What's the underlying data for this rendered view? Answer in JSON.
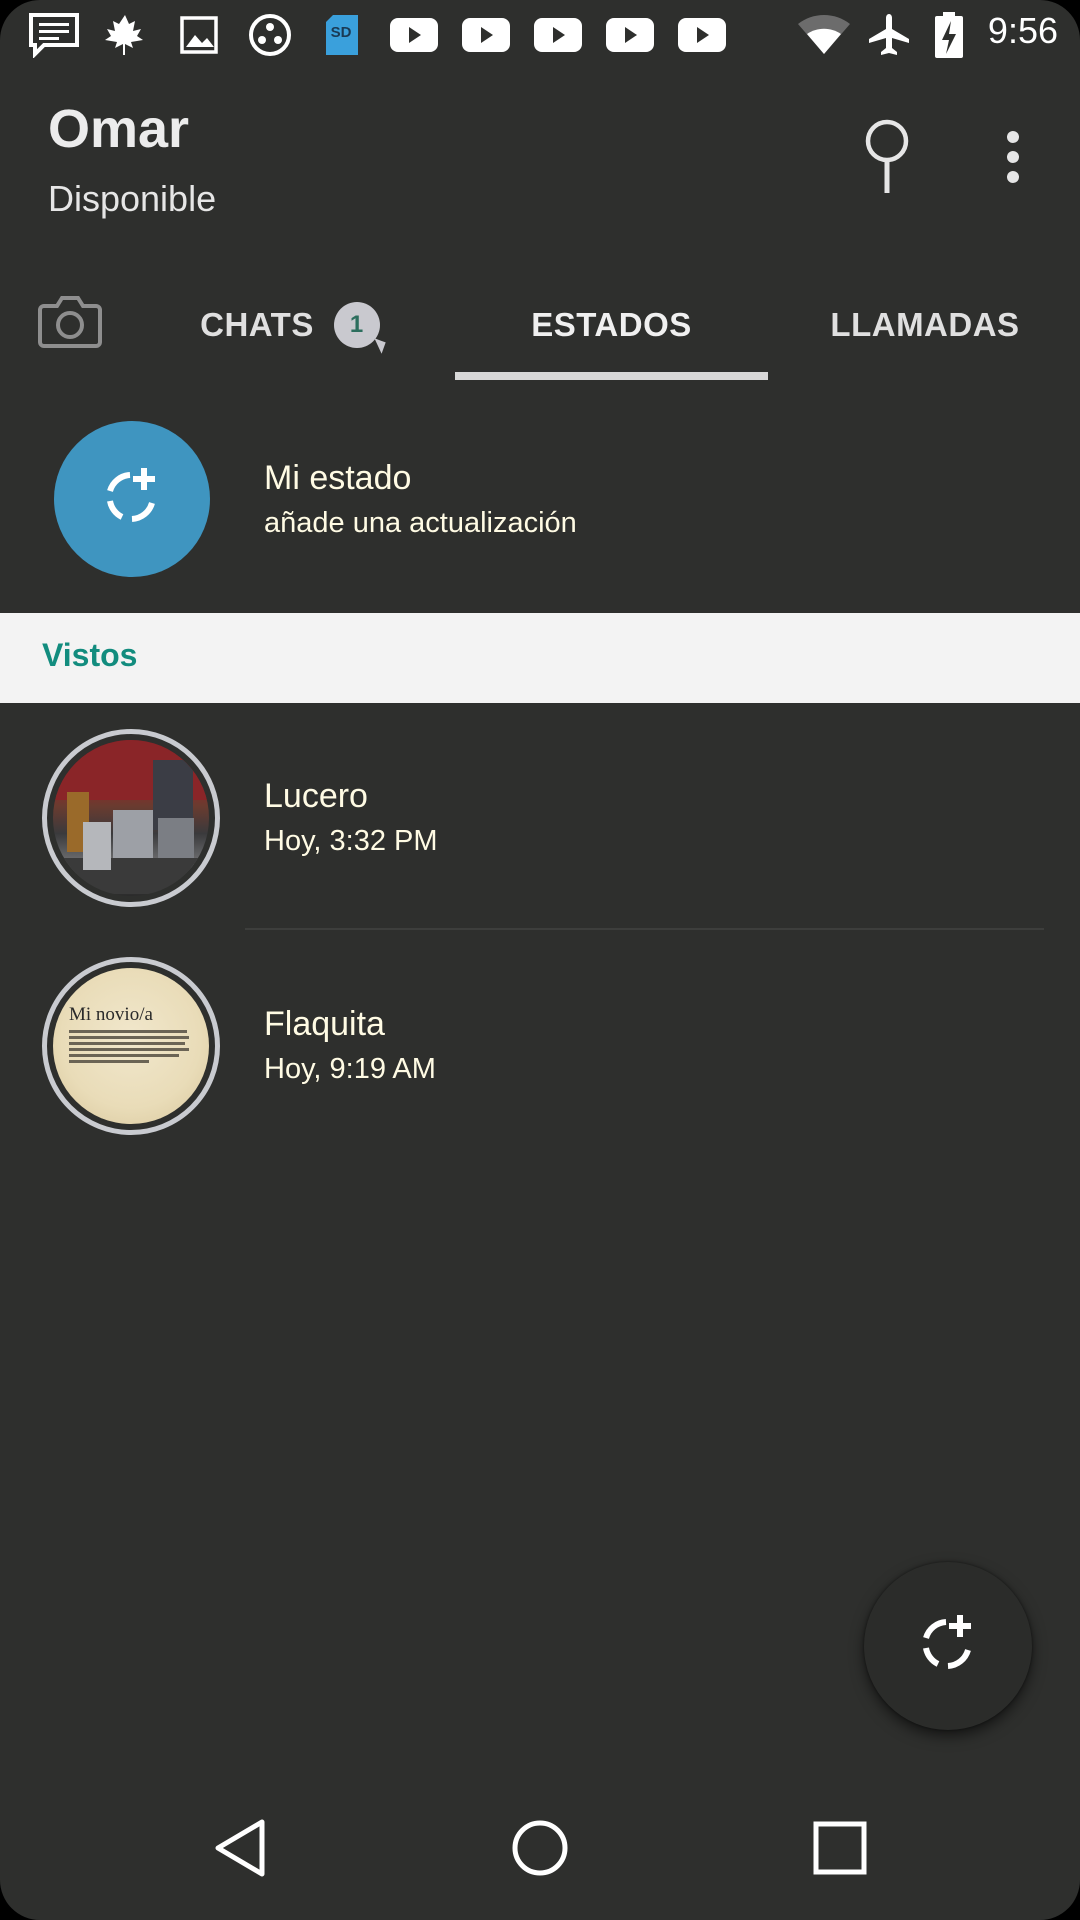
{
  "status_bar": {
    "time": "9:56",
    "left_icons": [
      "message-icon",
      "maple-leaf-icon",
      "image-icon",
      "app-circle-icon",
      "sd-card-icon",
      "youtube-icon",
      "youtube-icon",
      "youtube-icon",
      "youtube-icon",
      "youtube-icon"
    ],
    "sd_label": "SD",
    "right_icons": [
      "wifi-icon",
      "airplane-icon",
      "battery-charging-icon"
    ]
  },
  "header": {
    "title": "Omar",
    "subtitle": "Disponible",
    "actions": [
      "search-icon",
      "more-vert-icon"
    ]
  },
  "tabs": {
    "camera_icon": "camera-icon",
    "items": [
      {
        "label": "CHATS",
        "badge": "1"
      },
      {
        "label": "ESTADOS",
        "selected": true
      },
      {
        "label": "LLAMADAS"
      }
    ]
  },
  "my_status": {
    "title": "Mi estado",
    "subtitle": "añade una actualización"
  },
  "section": {
    "label": "Vistos"
  },
  "contacts": [
    {
      "name": "Lucero",
      "time": "Hoy, 3:32 PM"
    },
    {
      "name": "Flaquita",
      "time": "Hoy, 9:19 AM",
      "thumb_title": "Mi novio/a"
    }
  ],
  "colors": {
    "background": "#2e2f2d",
    "accent": "#128c7e",
    "avatar_blue": "#3f95c0",
    "section_bg": "#f3f3f3"
  },
  "fab": {
    "icon": "status-add-icon"
  },
  "nav": [
    "back-icon",
    "home-icon",
    "recents-icon"
  ]
}
